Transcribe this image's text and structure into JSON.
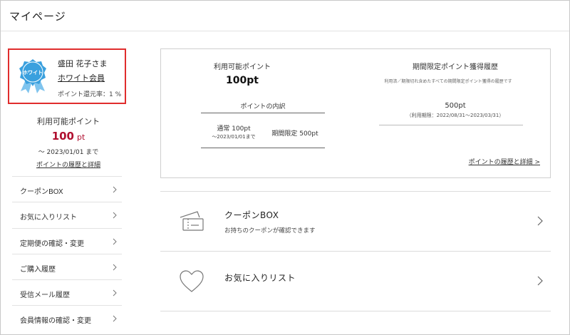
{
  "page": {
    "title": "マイページ"
  },
  "member": {
    "badge_text": "ホワイト",
    "name": "盛田 花子さま",
    "rank": "ホワイト会員",
    "rate": "ポイント還元率：1 %"
  },
  "left_points": {
    "label": "利用可能ポイント",
    "value": "100",
    "unit": "pt",
    "expiry": "～ 2023/01/01 まで",
    "link": "ポイントの履歴と詳細"
  },
  "side_menu": [
    {
      "label": "クーポンBOX"
    },
    {
      "label": "お気に入りリスト"
    },
    {
      "label": "定期便の確認・変更"
    },
    {
      "label": "ご購入履歴"
    },
    {
      "label": "受信メール履歴"
    },
    {
      "label": "会員情報の確認・変更"
    }
  ],
  "points_panel": {
    "available_label": "利用可能ポイント",
    "available_value": "100pt",
    "breakdown_title": "ポイントの内訳",
    "normal": "通常 100pt",
    "normal_expiry": "～2023/01/01まで",
    "limited": "期間限定 500pt",
    "limited_history_title": "期間限定ポイント獲得履歴",
    "limited_history_sub": "利用済／期限切れ含めたすべての期間限定ポイント獲得の履歴です",
    "limited_value": "500pt",
    "limited_period": "（利用期限：2022/08/31～2023/03/31）",
    "history_link": "ポイントの履歴と詳細 >"
  },
  "features": [
    {
      "title": "クーポンBOX",
      "desc": "お持ちのクーポンが確認できます",
      "icon": "ticket-icon"
    },
    {
      "title": "お気に入りリスト",
      "desc": "",
      "icon": "heart-icon"
    }
  ],
  "colors": {
    "accent": "#b01030",
    "highlight_border": "#e02d2d",
    "badge": "#3aa0de"
  }
}
